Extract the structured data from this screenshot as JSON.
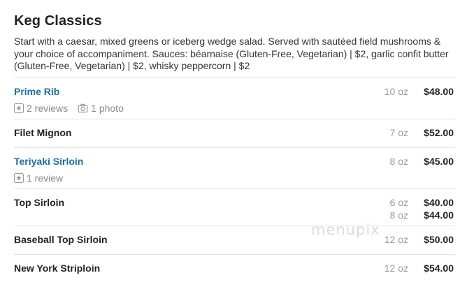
{
  "section": {
    "title": "Keg Classics",
    "description": "Start with a caesar, mixed greens or iceberg wedge salad. Served with sautéed field mushrooms & your choice of accompaniment. Sauces: béarnaise (Gluten-Free, Vegetarian) | $2, garlic confit butter (Gluten-Free, Vegetarian) | $2, whisky peppercorn | $2"
  },
  "items": [
    {
      "name": "Prime Rib",
      "size": "10 oz",
      "price": "$48.00",
      "reviews": "2 reviews",
      "photos": "1 photo"
    },
    {
      "name": "Filet Mignon",
      "size": "7 oz",
      "price": "$52.00"
    },
    {
      "name": "Teriyaki Sirloin",
      "size": "8 oz",
      "price": "$45.00",
      "reviews": "1 review"
    },
    {
      "name": "Top Sirloin",
      "size": "6 oz",
      "price": "$40.00",
      "size2": "8 oz",
      "price2": "$44.00"
    },
    {
      "name": "Baseball Top Sirloin",
      "size": "12 oz",
      "price": "$50.00"
    },
    {
      "name": "New York Striploin",
      "size": "12 oz",
      "price": "$54.00"
    }
  ],
  "watermark": "menupix",
  "icons": {
    "review": "star-in-square-icon",
    "photo": "camera-icon"
  },
  "colors": {
    "link": "#1d6fa5",
    "muted": "#888888"
  }
}
